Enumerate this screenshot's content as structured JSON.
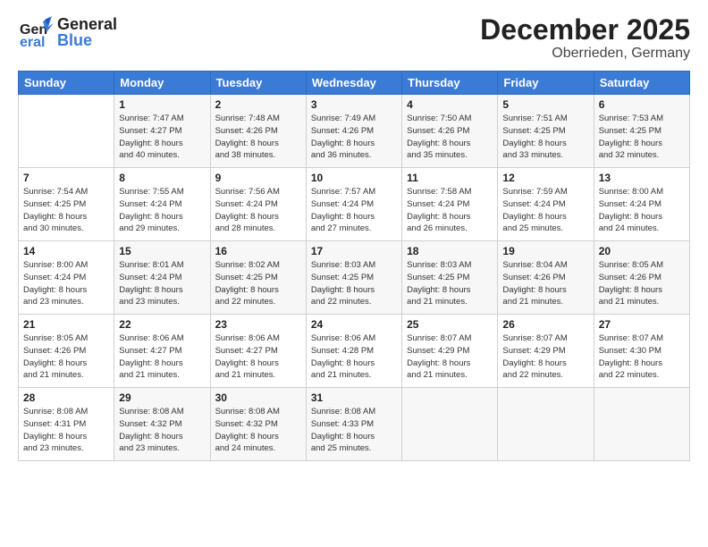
{
  "header": {
    "logo_general": "General",
    "logo_blue": "Blue",
    "title": "December 2025",
    "subtitle": "Oberrieden, Germany"
  },
  "weekdays": [
    "Sunday",
    "Monday",
    "Tuesday",
    "Wednesday",
    "Thursday",
    "Friday",
    "Saturday"
  ],
  "weeks": [
    [
      {
        "day": "",
        "info": ""
      },
      {
        "day": "1",
        "info": "Sunrise: 7:47 AM\nSunset: 4:27 PM\nDaylight: 8 hours\nand 40 minutes."
      },
      {
        "day": "2",
        "info": "Sunrise: 7:48 AM\nSunset: 4:26 PM\nDaylight: 8 hours\nand 38 minutes."
      },
      {
        "day": "3",
        "info": "Sunrise: 7:49 AM\nSunset: 4:26 PM\nDaylight: 8 hours\nand 36 minutes."
      },
      {
        "day": "4",
        "info": "Sunrise: 7:50 AM\nSunset: 4:26 PM\nDaylight: 8 hours\nand 35 minutes."
      },
      {
        "day": "5",
        "info": "Sunrise: 7:51 AM\nSunset: 4:25 PM\nDaylight: 8 hours\nand 33 minutes."
      },
      {
        "day": "6",
        "info": "Sunrise: 7:53 AM\nSunset: 4:25 PM\nDaylight: 8 hours\nand 32 minutes."
      }
    ],
    [
      {
        "day": "7",
        "info": "Sunrise: 7:54 AM\nSunset: 4:25 PM\nDaylight: 8 hours\nand 30 minutes."
      },
      {
        "day": "8",
        "info": "Sunrise: 7:55 AM\nSunset: 4:24 PM\nDaylight: 8 hours\nand 29 minutes."
      },
      {
        "day": "9",
        "info": "Sunrise: 7:56 AM\nSunset: 4:24 PM\nDaylight: 8 hours\nand 28 minutes."
      },
      {
        "day": "10",
        "info": "Sunrise: 7:57 AM\nSunset: 4:24 PM\nDaylight: 8 hours\nand 27 minutes."
      },
      {
        "day": "11",
        "info": "Sunrise: 7:58 AM\nSunset: 4:24 PM\nDaylight: 8 hours\nand 26 minutes."
      },
      {
        "day": "12",
        "info": "Sunrise: 7:59 AM\nSunset: 4:24 PM\nDaylight: 8 hours\nand 25 minutes."
      },
      {
        "day": "13",
        "info": "Sunrise: 8:00 AM\nSunset: 4:24 PM\nDaylight: 8 hours\nand 24 minutes."
      }
    ],
    [
      {
        "day": "14",
        "info": "Sunrise: 8:00 AM\nSunset: 4:24 PM\nDaylight: 8 hours\nand 23 minutes."
      },
      {
        "day": "15",
        "info": "Sunrise: 8:01 AM\nSunset: 4:24 PM\nDaylight: 8 hours\nand 23 minutes."
      },
      {
        "day": "16",
        "info": "Sunrise: 8:02 AM\nSunset: 4:25 PM\nDaylight: 8 hours\nand 22 minutes."
      },
      {
        "day": "17",
        "info": "Sunrise: 8:03 AM\nSunset: 4:25 PM\nDaylight: 8 hours\nand 22 minutes."
      },
      {
        "day": "18",
        "info": "Sunrise: 8:03 AM\nSunset: 4:25 PM\nDaylight: 8 hours\nand 21 minutes."
      },
      {
        "day": "19",
        "info": "Sunrise: 8:04 AM\nSunset: 4:26 PM\nDaylight: 8 hours\nand 21 minutes."
      },
      {
        "day": "20",
        "info": "Sunrise: 8:05 AM\nSunset: 4:26 PM\nDaylight: 8 hours\nand 21 minutes."
      }
    ],
    [
      {
        "day": "21",
        "info": "Sunrise: 8:05 AM\nSunset: 4:26 PM\nDaylight: 8 hours\nand 21 minutes."
      },
      {
        "day": "22",
        "info": "Sunrise: 8:06 AM\nSunset: 4:27 PM\nDaylight: 8 hours\nand 21 minutes."
      },
      {
        "day": "23",
        "info": "Sunrise: 8:06 AM\nSunset: 4:27 PM\nDaylight: 8 hours\nand 21 minutes."
      },
      {
        "day": "24",
        "info": "Sunrise: 8:06 AM\nSunset: 4:28 PM\nDaylight: 8 hours\nand 21 minutes."
      },
      {
        "day": "25",
        "info": "Sunrise: 8:07 AM\nSunset: 4:29 PM\nDaylight: 8 hours\nand 21 minutes."
      },
      {
        "day": "26",
        "info": "Sunrise: 8:07 AM\nSunset: 4:29 PM\nDaylight: 8 hours\nand 22 minutes."
      },
      {
        "day": "27",
        "info": "Sunrise: 8:07 AM\nSunset: 4:30 PM\nDaylight: 8 hours\nand 22 minutes."
      }
    ],
    [
      {
        "day": "28",
        "info": "Sunrise: 8:08 AM\nSunset: 4:31 PM\nDaylight: 8 hours\nand 23 minutes."
      },
      {
        "day": "29",
        "info": "Sunrise: 8:08 AM\nSunset: 4:32 PM\nDaylight: 8 hours\nand 23 minutes."
      },
      {
        "day": "30",
        "info": "Sunrise: 8:08 AM\nSunset: 4:32 PM\nDaylight: 8 hours\nand 24 minutes."
      },
      {
        "day": "31",
        "info": "Sunrise: 8:08 AM\nSunset: 4:33 PM\nDaylight: 8 hours\nand 25 minutes."
      },
      {
        "day": "",
        "info": ""
      },
      {
        "day": "",
        "info": ""
      },
      {
        "day": "",
        "info": ""
      }
    ]
  ]
}
